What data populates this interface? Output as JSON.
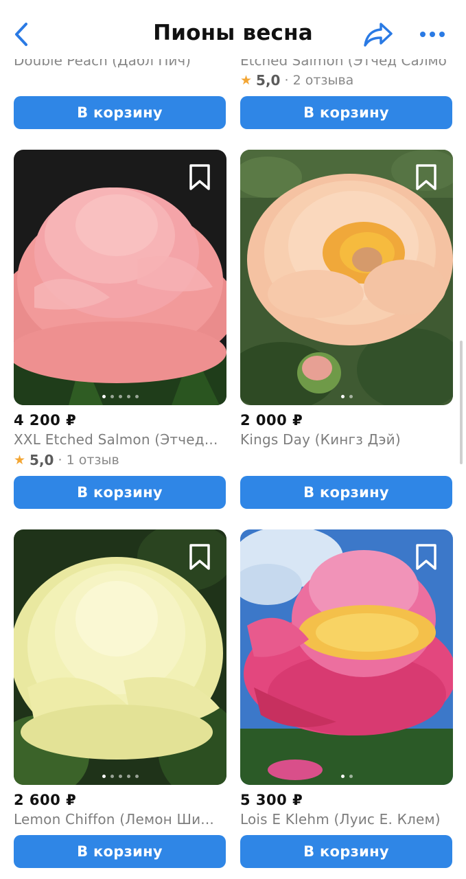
{
  "header": {
    "title": "Пионы весна",
    "back_icon": "chevron-left-icon",
    "share_icon": "share-arrow-icon",
    "more_icon": "more-dots-icon"
  },
  "top_partial": {
    "left_name": "Double Peach (Дабл Пич)",
    "right_name": "Etched Salmon (Этчед Салмон)",
    "right_rating": {
      "score": "5,0",
      "reviews": "· 2 отзыва"
    },
    "left_button": "В корзину",
    "right_button": "В корзину"
  },
  "products": [
    {
      "price": "4 200 ₽",
      "name": "XXL Etched Salmon (Этчед...",
      "rating": {
        "score": "5,0",
        "reviews": "· 1 отзыв"
      },
      "button": "В корзину"
    },
    {
      "price": "2 000 ₽",
      "name": "Kings Day (Кингз Дэй)",
      "button": "В корзину"
    },
    {
      "price": "2 600 ₽",
      "name": "Lemon Chiffon (Лемон Ши...",
      "button": "В корзину"
    },
    {
      "price": "5 300 ₽",
      "name": "Lois E Klehm (Луис Е. Клем)",
      "button": "В корзину"
    }
  ],
  "colors": {
    "accent": "#2f86e6",
    "star": "#f3a634"
  }
}
